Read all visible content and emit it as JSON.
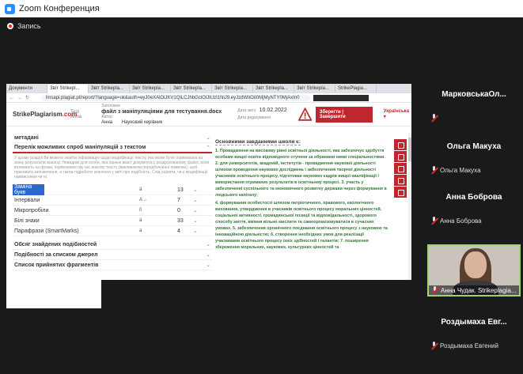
{
  "window": {
    "title": "Zoom Конференция"
  },
  "recording": {
    "label": "Запись"
  },
  "browser": {
    "tabs": [
      "Документи",
      "Звіт Strikepl...",
      "Звіт Strikepla...",
      "Звіт Strikepla...",
      "Звіт Strikepla...",
      "Звіт Strikepla...",
      "Звіт Strikepla...",
      "Звіт Strikepla...",
      "StrikePlagia..."
    ],
    "url": "lmsapi.plagiat.pl/report/?language=uk&auth=eyJ0eXAiOiJKV1QiLCJhbGciOiJIUzI1NiJ9.eyJzdWIiOiI0MjMyNTY0MjAxIn0"
  },
  "app": {
    "logo_text": "StrikePlagiarism",
    "logo_domain": ".com",
    "test_label": "Test Anna",
    "title_caption": "Заголовок",
    "file_name": "файл з маніпуляціями для тестування.docx",
    "author_caption": "Автор",
    "author": "Анна",
    "supervisor_caption": "Науковий керівник",
    "date_caption": "Дата звіту",
    "date_value": "10.02.2022",
    "edit_caption": "Дата редагування",
    "save_label": "Зберегти | Завершити",
    "language": "Українська ▾"
  },
  "sidebar": {
    "metadata": "метадані",
    "manipulations_title": "Перелік можливих спроб маніпуляцій з текстом",
    "description": "У цьому розділі Ви можете знайти інформацію щодо модифікації тексту, яка може бути спрямована на зміну результатів аналізу. Невидимі для особи, яка оцінює вміст документа у роздрукованому файлі, вони впливають на фрази, порівнювані під час аналізу тексту (викликаючи передбачувані помилки), щоб приховати запозичення, а також підробити значення у звіті про подібність. Слід оцінити, чи є модифікації навмисними чи ні.",
    "manipulations": [
      {
        "name": "Заміна букв",
        "icon": "ä",
        "count": "13"
      },
      {
        "name": "Інтервали",
        "icon": "A→",
        "count": "7"
      },
      {
        "name": "Мікропробіли",
        "icon": "0",
        "count": "0"
      },
      {
        "name": "Білі знаки",
        "icon": "ä",
        "count": "33"
      },
      {
        "name": "Парафрази (SmartMarks)",
        "icon": "a",
        "count": "4"
      }
    ],
    "similarity_volume": "Обсяг знайдених подібностей",
    "similarity_sources": "Подібності за списком джерел",
    "accepted_fragments": "Список прийнятих фрагментів"
  },
  "document": {
    "heading": "Основними завданнями школи є:",
    "paragraphs": [
      "1. Провадження на високому рівні освітньої діяльності, яка забезпечує здобуття особами вищої освіти відповідного ступеня за обраними ними спеціальностями. 2. для університетів, академій, інститутів - провадження наукової діяльності шляхом проведення наукових досліджень і забезпечення творчої діяльності учасників освітнього процесу, підготовки наукових кадрів вищої кваліфікації і використання отриманих результатів в освітньому процесі. 3. участь у забезпеченні суспільного та економічного розвитку держави через формування в людського капіталу;",
      "4. формування особистості шляхом патріотичного, правового, екологічного виховання, утвердження в учасників освітнього процесу моральних цінностей, соціальної активності, громадянської позиції та відповідальності, здорового способу життя, вміння вільно мислити та самоорганізовуватися в сучасних умовах. 5. забезпечення органічного поєднання освітнього процесу з науковою та інноваційною діяльністю; 6. створення необхідних умов для реалізації учасниками освітнього процесу їхніх здібностей і талантів; 7. поширення збереження моральних, наукових, культурних цінностей та"
    ]
  },
  "participants": [
    {
      "name": "МарковськаОл...",
      "tag": ""
    },
    {
      "name": "Ольга Макуха",
      "tag": "Ольга Макуха"
    },
    {
      "name": "Анна Боброва",
      "tag": "Анна Боброва"
    },
    {
      "name": "Роздымаха  Евг...",
      "tag": "Роздымаха Евгений"
    }
  ],
  "video": {
    "tag": "Анна Чудак. Strikeplagia..."
  }
}
